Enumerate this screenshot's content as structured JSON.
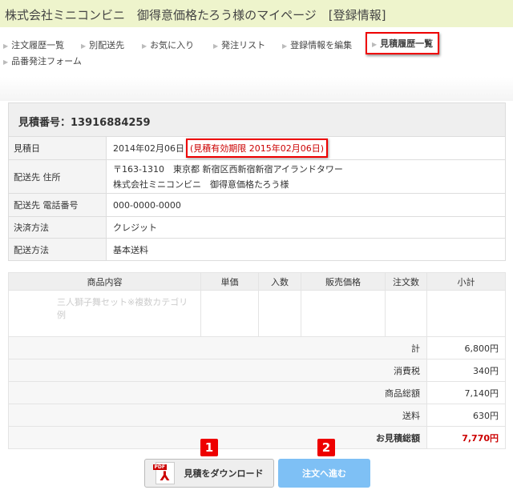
{
  "header": {
    "title": "株式会社ミニコンビニ　御得意価格たろう様のマイページ　[登録情報]"
  },
  "nav": {
    "items": [
      "注文履歴一覧",
      "別配送先",
      "お気に入り",
      "発注リスト",
      "登録情報を編集",
      "見積履歴一覧",
      "品番発注フォーム"
    ]
  },
  "quote": {
    "title": "見積番号：13916884259",
    "rows": [
      {
        "label": "見積日",
        "value": "2014年02月06日",
        "expiry": "(見積有効期限 2015年02月06日)"
      },
      {
        "label": "配送先 住所",
        "value": "〒163-1310　東京都 新宿区西新宿新宿アイランドタワー",
        "value2": "株式会社ミニコンビニ　御得意価格たろう様"
      },
      {
        "label": "配送先 電話番号",
        "value": "000-0000-0000"
      },
      {
        "label": "決済方法",
        "value": "クレジット"
      },
      {
        "label": "配送方法",
        "value": "基本送料"
      }
    ]
  },
  "items": {
    "headers": [
      "商品内容",
      "単価",
      "入数",
      "販売価格",
      "注文数",
      "小計"
    ],
    "product_name": "三人獅子舞セット※複数カテゴリ例"
  },
  "totals": [
    {
      "label": "計",
      "value": "6,800円"
    },
    {
      "label": "消費税",
      "value": "340円"
    },
    {
      "label": "商品総額",
      "value": "7,140円"
    },
    {
      "label": "送料",
      "value": "630円"
    },
    {
      "label": "お見積総額",
      "value": "7,770円"
    }
  ],
  "buttons": {
    "download": "見積をダウンロード",
    "order": "注文へ進む",
    "pdf_icon_text": "PDF"
  },
  "badges": [
    "1",
    "2"
  ]
}
